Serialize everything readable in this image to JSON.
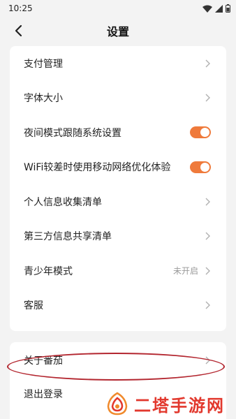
{
  "status": {
    "time": "10:25"
  },
  "header": {
    "title": "设置"
  },
  "settings": [
    {
      "label": "支付管理"
    },
    {
      "label": "字体大小"
    },
    {
      "label": "夜间模式跟随系统设置"
    },
    {
      "label": "WiFi较差时使用移动网络优化体验"
    },
    {
      "label": "个人信息收集清单"
    },
    {
      "label": "第三方信息共享清单"
    },
    {
      "label": "青少年模式",
      "value": "未开启"
    },
    {
      "label": "客服"
    }
  ],
  "toggles": {
    "night_mode": true,
    "wifi_optimization": true
  },
  "more": [
    {
      "label": "关于番茄"
    },
    {
      "label": "退出登录"
    }
  ],
  "watermark": {
    "text": "二塔手游网"
  },
  "colors": {
    "accent": "#ef7a3b",
    "annotation": "#b3262f",
    "watermark": "#e2382d"
  }
}
